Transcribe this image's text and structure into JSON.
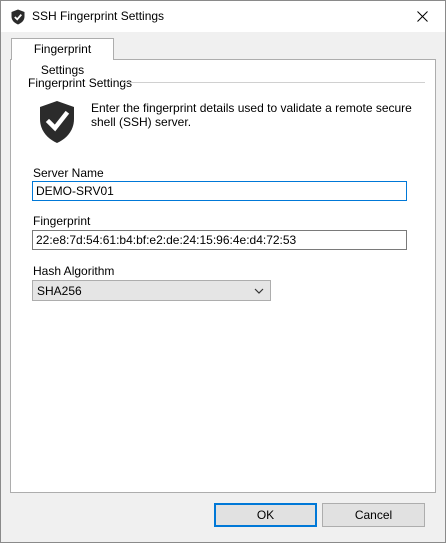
{
  "window": {
    "title": "SSH Fingerprint Settings",
    "icon": "shield-check-icon",
    "close_icon": "close-icon"
  },
  "tabs": [
    {
      "label": "Fingerprint Settings",
      "selected": true
    }
  ],
  "group": {
    "title": "Fingerprint Settings",
    "icon": "shield-check-icon",
    "description": "Enter the fingerprint details used to validate a remote secure shell (SSH) server."
  },
  "fields": {
    "server_name": {
      "label": "Server Name",
      "value": "DEMO-SRV01"
    },
    "fingerprint": {
      "label": "Fingerprint",
      "value": "22:e8:7d:54:61:b4:bf:e2:de:24:15:96:4e:d4:72:53"
    },
    "hash_algorithm": {
      "label": "Hash Algorithm",
      "selected": "SHA256"
    }
  },
  "buttons": {
    "ok": "OK",
    "cancel": "Cancel"
  },
  "colors": {
    "accent": "#0078d7",
    "shield": "#2b2b2b"
  }
}
